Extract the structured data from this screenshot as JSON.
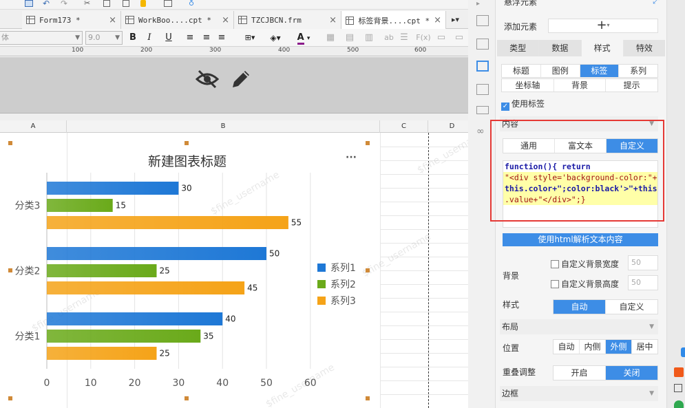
{
  "tabs": [
    {
      "label": "Form173 *",
      "active": false
    },
    {
      "label": "WorkBoo....cpt *",
      "active": false
    },
    {
      "label": "TZCJBCN.frm",
      "active": false
    },
    {
      "label": "标签背景....cpt *",
      "active": true
    }
  ],
  "format_toolbar": {
    "font_name": "体",
    "font_size": "9.0",
    "bold": "B",
    "italic": "I",
    "underline": "U",
    "font_color_glyph": "A",
    "rich_text_label": "ab",
    "formula_label": "F(x)"
  },
  "ruler": {
    "labels": [
      "100",
      "200",
      "300",
      "400",
      "500",
      "600"
    ]
  },
  "columns": [
    "A",
    "B",
    "C",
    "D"
  ],
  "chart_data": {
    "type": "bar",
    "orientation": "horizontal",
    "title": "新建图表标题",
    "categories": [
      "分类1",
      "分类2",
      "分类3"
    ],
    "series": [
      {
        "name": "系列1",
        "color": "#1e78d6",
        "values": [
          40,
          50,
          30
        ]
      },
      {
        "name": "系列2",
        "color": "#6aaa1a",
        "values": [
          35,
          25,
          15
        ]
      },
      {
        "name": "系列3",
        "color": "#f5a318",
        "values": [
          25,
          45,
          55
        ]
      }
    ],
    "xaxis_ticks": [
      "0",
      "10",
      "20",
      "30",
      "40",
      "50",
      "60"
    ],
    "xlim": [
      0,
      60
    ],
    "grid": true,
    "legend_position": "right",
    "more_menu": "···"
  },
  "watermark": "$fine_username",
  "panel": {
    "header_title": "悬浮元素",
    "add_element_label": "添加元素",
    "add_element_button": "+",
    "main_tabs": [
      {
        "label": "类型",
        "active": false
      },
      {
        "label": "数据",
        "active": false
      },
      {
        "label": "样式",
        "active": true
      },
      {
        "label": "特效",
        "active": false
      }
    ],
    "sub_tabs_row1": [
      {
        "label": "标题",
        "active": false
      },
      {
        "label": "图例",
        "active": false
      },
      {
        "label": "标签",
        "active": true
      },
      {
        "label": "系列",
        "active": false
      }
    ],
    "sub_tabs_row2": [
      {
        "label": "坐标轴",
        "active": false
      },
      {
        "label": "背景",
        "active": false
      },
      {
        "label": "提示",
        "active": false
      }
    ],
    "use_label_checkbox": "使用标签",
    "content_section": "内容",
    "content_mode_tabs": [
      {
        "label": "通用",
        "active": false
      },
      {
        "label": "富文本",
        "active": false
      },
      {
        "label": "自定义",
        "active": true
      }
    ],
    "code_lines": [
      "function(){ return",
      "\"<div style='background-color:\"+",
      "this.color+\";color:black'>\"+this",
      ".value+\"</div>\";}"
    ],
    "html_parse_button": "使用html解析文本内容",
    "background_label": "背景",
    "custom_bg_width": "自定义背景宽度",
    "custom_bg_width_value": "50",
    "custom_bg_height": "自定义背景高度",
    "custom_bg_height_value": "50",
    "style_label": "样式",
    "style_options": [
      {
        "label": "自动",
        "active": true
      },
      {
        "label": "自定义",
        "active": false
      }
    ],
    "layout_section": "布局",
    "position_label": "位置",
    "position_options": [
      {
        "label": "自动",
        "active": false
      },
      {
        "label": "内侧",
        "active": false
      },
      {
        "label": "外侧",
        "active": true
      },
      {
        "label": "居中",
        "active": false
      }
    ],
    "overlap_label": "重叠调整",
    "overlap_options": [
      {
        "label": "开启",
        "active": false
      },
      {
        "label": "关闭",
        "active": true
      }
    ],
    "border_section": "边框"
  },
  "colors": {
    "accent": "#3d8de6",
    "highlight_box": "#e53935",
    "code_highlight": "#ffffa8"
  }
}
